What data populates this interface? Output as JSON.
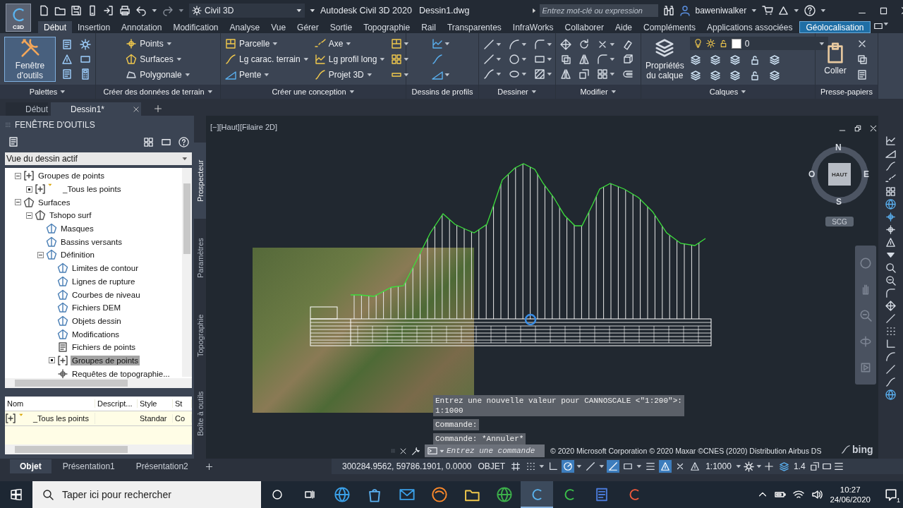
{
  "title_bar": {
    "app_badge": "C3D",
    "workspace": "Civil 3D",
    "title": "Autodesk Civil 3D 2020",
    "file_name": "Dessin1.dwg",
    "search": {
      "placeholder": "Entrez mot-clé ou expression"
    },
    "user": "baweniwalker"
  },
  "ribbon_tabs": [
    {
      "label": "Début",
      "selected": true,
      "highlighted": false
    },
    {
      "label": "Insertion",
      "selected": false,
      "highlighted": false
    },
    {
      "label": "Annotation",
      "selected": false,
      "highlighted": false
    },
    {
      "label": "Modification",
      "selected": false,
      "highlighted": false
    },
    {
      "label": "Analyse",
      "selected": false,
      "highlighted": false
    },
    {
      "label": "Vue",
      "selected": false,
      "highlighted": false
    },
    {
      "label": "Gérer",
      "selected": false,
      "highlighted": false
    },
    {
      "label": "Sortie",
      "selected": false,
      "highlighted": false
    },
    {
      "label": "Topographie",
      "selected": false,
      "highlighted": false
    },
    {
      "label": "Rail",
      "selected": false,
      "highlighted": false
    },
    {
      "label": "Transparentes",
      "selected": false,
      "highlighted": false
    },
    {
      "label": "InfraWorks",
      "selected": false,
      "highlighted": false
    },
    {
      "label": "Collaborer",
      "selected": false,
      "highlighted": false
    },
    {
      "label": "Aide",
      "selected": false,
      "highlighted": false
    },
    {
      "label": "Compléments",
      "selected": false,
      "highlighted": false
    },
    {
      "label": "Applications associées",
      "selected": false,
      "highlighted": false
    },
    {
      "label": "Géolocalisation",
      "selected": false,
      "highlighted": true
    }
  ],
  "ribbon_panels": [
    {
      "kind": "palettes",
      "title": "Palettes",
      "menu": true,
      "big_button": "Fenêtre d'outils"
    },
    {
      "kind": "terrain",
      "title": "Créer des données de terrain",
      "menu": true,
      "columns": [
        [
          "Points",
          "Surfaces",
          "Polygonale"
        ]
      ]
    },
    {
      "kind": "design",
      "title": "Créer une conception",
      "menu": true,
      "columns": [
        [
          "Parcelle",
          "Lg carac. terrain",
          "Pente"
        ],
        [
          "Axe",
          "Lg profil long",
          "Projet 3D"
        ]
      ]
    },
    {
      "kind": "profile_tools",
      "title": "Dessins de profils",
      "menu": false
    },
    {
      "kind": "draw_tools",
      "title": "Dessiner",
      "menu": true
    },
    {
      "kind": "modify_tools",
      "title": "Modifier",
      "menu": true
    },
    {
      "kind": "layers",
      "title": "Calques",
      "menu": true,
      "big_button": "Propriétés du calque",
      "layer": "0"
    },
    {
      "kind": "clipboard",
      "title": "Presse-papiers",
      "menu": false,
      "big_button": "Coller"
    }
  ],
  "file_tabs": [
    {
      "label": "Début",
      "selected": false
    },
    {
      "label": "Dessin1*",
      "selected": true
    }
  ],
  "toolspace": {
    "title": "FENÊTRE D'OUTILS",
    "view": "Vue du dessin actif",
    "tree": [
      {
        "label": "Groupes de points",
        "kind": "point_group",
        "expanded": true,
        "selected": false,
        "children": [
          {
            "label": "_Tous les points",
            "kind": "point_group_flag",
            "expanded": false,
            "selected": false
          }
        ]
      },
      {
        "label": "Surfaces",
        "kind": "surface",
        "expanded": true,
        "selected": false,
        "children": [
          {
            "label": "Tshopo surf",
            "kind": "surface",
            "expanded": true,
            "selected": false,
            "children": [
              {
                "label": "Masques",
                "kind": "surface_item",
                "selected": false
              },
              {
                "label": "Bassins versants",
                "kind": "surface_item",
                "selected": false
              },
              {
                "label": "Définition",
                "kind": "surface_item",
                "expanded": true,
                "selected": false,
                "children": [
                  {
                    "label": "Limites de contour",
                    "kind": "surface_item",
                    "selected": false
                  },
                  {
                    "label": "Lignes de rupture",
                    "kind": "surface_item",
                    "selected": false
                  },
                  {
                    "label": "Courbes de niveau",
                    "kind": "surface_item",
                    "selected": false
                  },
                  {
                    "label": "Fichiers DEM",
                    "kind": "surface_item",
                    "selected": false
                  },
                  {
                    "label": "Objets dessin",
                    "kind": "surface_item",
                    "selected": false
                  },
                  {
                    "label": "Modifications",
                    "kind": "surface_item",
                    "selected": false
                  },
                  {
                    "label": "Fichiers de points",
                    "kind": "point_file",
                    "selected": false
                  },
                  {
                    "label": "Groupes de points",
                    "kind": "point_group",
                    "expanded": false,
                    "selected": true
                  },
                  {
                    "label": "Requêtes de topographie...",
                    "kind": "query",
                    "selected": false
                  }
                ]
              }
            ]
          }
        ]
      }
    ],
    "list": {
      "columns": [
        "Nom",
        "Descript...",
        "Style",
        "St"
      ],
      "rows": [
        {
          "name": "_Tous les points",
          "style": "Standar",
          "column_4": "Co"
        }
      ]
    },
    "side_tabs": [
      {
        "label": "Prospecteur",
        "selected": true
      },
      {
        "label": "Paramètres",
        "selected": false
      },
      {
        "label": "Topographie",
        "selected": false
      },
      {
        "label": "Boîte à outils",
        "selected": false
      }
    ]
  },
  "viewport": {
    "label": "[−][Haut][Filaire 2D]",
    "viewcube": {
      "face": "HAUT",
      "north": "N",
      "south": "S",
      "east": "E",
      "west": "O",
      "ucs": "SCG"
    },
    "command_history": [
      [
        "Entrez une nouvelle valeur pour CANNOSCALE <\"1:200\">:",
        "1:1000"
      ],
      [
        "Commande:"
      ],
      [
        "Commande: *Annuler*"
      ]
    ],
    "command_line": {
      "placeholder": "Entrez une commande"
    },
    "attribution": "© 2020 Microsoft Corporation © 2020 Maxar ©CNES (2020) Distribution Airbus DS",
    "map_logo": "bing"
  },
  "layout_tabs": [
    {
      "label": "Objet",
      "selected": true
    },
    {
      "label": "Présentation1",
      "selected": false
    },
    {
      "label": "Présentation2",
      "selected": false
    }
  ],
  "status_bar": {
    "coordinates": "300284.9562, 59786.1901, 0.0000",
    "space": "OBJET",
    "scale": "1:1000",
    "scale_factor": "1.4",
    "toggles": [
      {
        "kind": "grid",
        "on": false
      },
      {
        "kind": "snap",
        "on": false
      },
      {
        "kind": "ortho",
        "on": false
      },
      {
        "kind": "polar",
        "on": true
      },
      {
        "kind": "osnap",
        "on": false
      },
      {
        "kind": "tracking",
        "on": true
      },
      {
        "kind": "object_snap",
        "on": false
      },
      {
        "kind": "lineweight",
        "on": false
      },
      {
        "kind": "annotation",
        "on": true
      },
      {
        "kind": "auto_scale",
        "on": false
      },
      {
        "kind": "annotation_scale",
        "on": false
      }
    ]
  },
  "taskbar": {
    "search": {
      "placeholder": "Taper ici pour rechercher"
    },
    "apps": [
      {
        "kind": "edge",
        "active": false
      },
      {
        "kind": "store",
        "active": false
      },
      {
        "kind": "mail",
        "active": false
      },
      {
        "kind": "firefox",
        "active": false
      },
      {
        "kind": "explorer",
        "active": false
      },
      {
        "kind": "download_manager",
        "active": false
      },
      {
        "kind": "civil3d",
        "active": true
      },
      {
        "kind": "camtasia_green",
        "active": false
      },
      {
        "kind": "word",
        "active": false
      },
      {
        "kind": "camtasia_red",
        "active": false
      }
    ],
    "time": "10:27",
    "date": "24/06/2020",
    "notifications": "1"
  }
}
